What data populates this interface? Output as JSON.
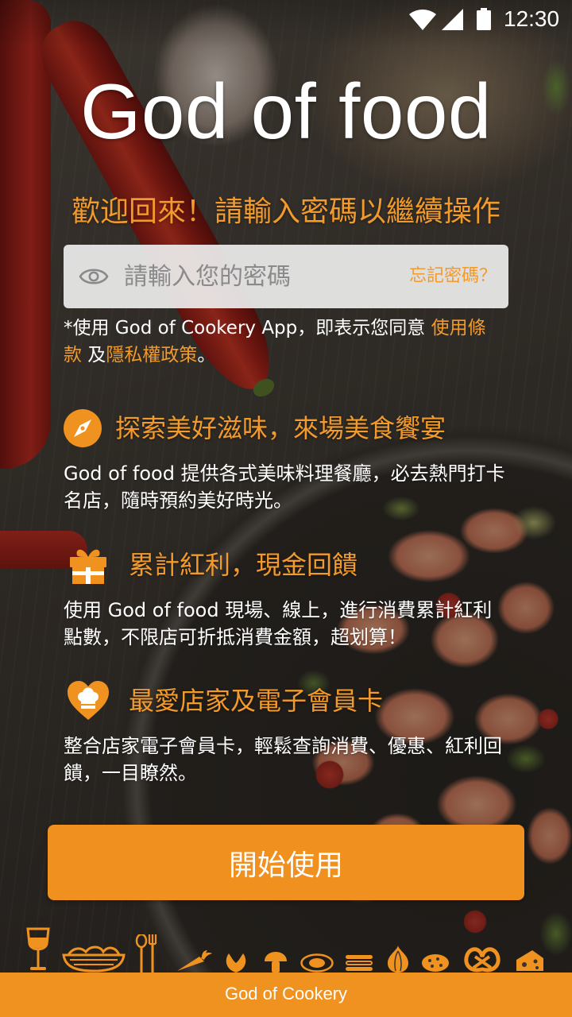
{
  "status_bar": {
    "time": "12:30",
    "icons": [
      "wifi-icon",
      "signal-icon",
      "battery-icon"
    ]
  },
  "app_title": "God of food",
  "welcome_message": "歡迎回來！請輸入密碼以繼續操作",
  "password_field": {
    "placeholder": "請輸入您的密碼",
    "toggle_icon": "eye-icon",
    "forgot_password_label": "忘記密碼？"
  },
  "terms_notice": {
    "prefix": "*使用 God of Cookery App，即表示您同意 ",
    "terms_link": "使用條款",
    "conjunction": " 及",
    "privacy_link": "隱私權政策",
    "suffix": "。"
  },
  "features": [
    {
      "icon": "compass-icon",
      "title": "探索美好滋味，來場美食饗宴",
      "description": "God of food 提供各式美味料理餐廳，必去熱門打卡名店，隨時預約美好時光。"
    },
    {
      "icon": "gift-icon",
      "title": "累計紅利，現金回饋",
      "description": "使用 God of food 現場、線上，進行消費累計紅利點數，不限店可折抵消費金額，超划算！"
    },
    {
      "icon": "heart-chef-hat-icon",
      "title": "最愛店家及電子會員卡",
      "description": "整合店家電子會員卡，輕鬆查詢消費、優惠、紅利回饋，一目瞭然。"
    }
  ],
  "start_button_label": "開始使用",
  "food_icons": [
    "wine-glass-icon",
    "noodle-bowl-icon",
    "utensils-icon",
    "carrot-icon",
    "leaf-icon",
    "mushroom-icon",
    "fried-egg-icon",
    "sushi-icon",
    "onion-icon",
    "cookie-icon",
    "pretzel-icon",
    "cheese-icon"
  ],
  "footer": {
    "brand": "God of Cookery"
  },
  "colors": {
    "accent": "#F29A2C",
    "button": "#EF901F",
    "footer": "#F0921F",
    "input_background": "#ECECEC",
    "placeholder": "#8A8A8A",
    "body_text": "#FFFFFF"
  }
}
